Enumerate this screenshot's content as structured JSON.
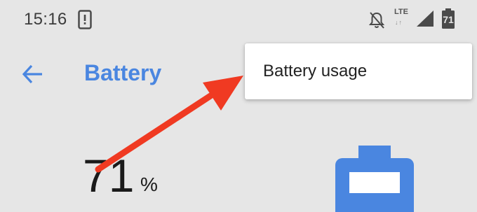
{
  "status_bar": {
    "time": "15:16",
    "network_label": "LTE",
    "network_arrows": "↓↑",
    "battery_level": "71",
    "icons": [
      "phone-icon",
      "bell-off-icon",
      "signal-icon",
      "battery-icon"
    ]
  },
  "app_bar": {
    "title": "Battery",
    "back_icon": "arrow-left-icon"
  },
  "menu": {
    "items": [
      {
        "label": "Battery usage"
      }
    ]
  },
  "battery": {
    "percent": "71",
    "percent_sign": "%"
  },
  "colors": {
    "background": "#e6e6e6",
    "accent": "#4a86e0",
    "annotation_arrow": "#f03a22",
    "battery_fill": "#4a86e0"
  }
}
